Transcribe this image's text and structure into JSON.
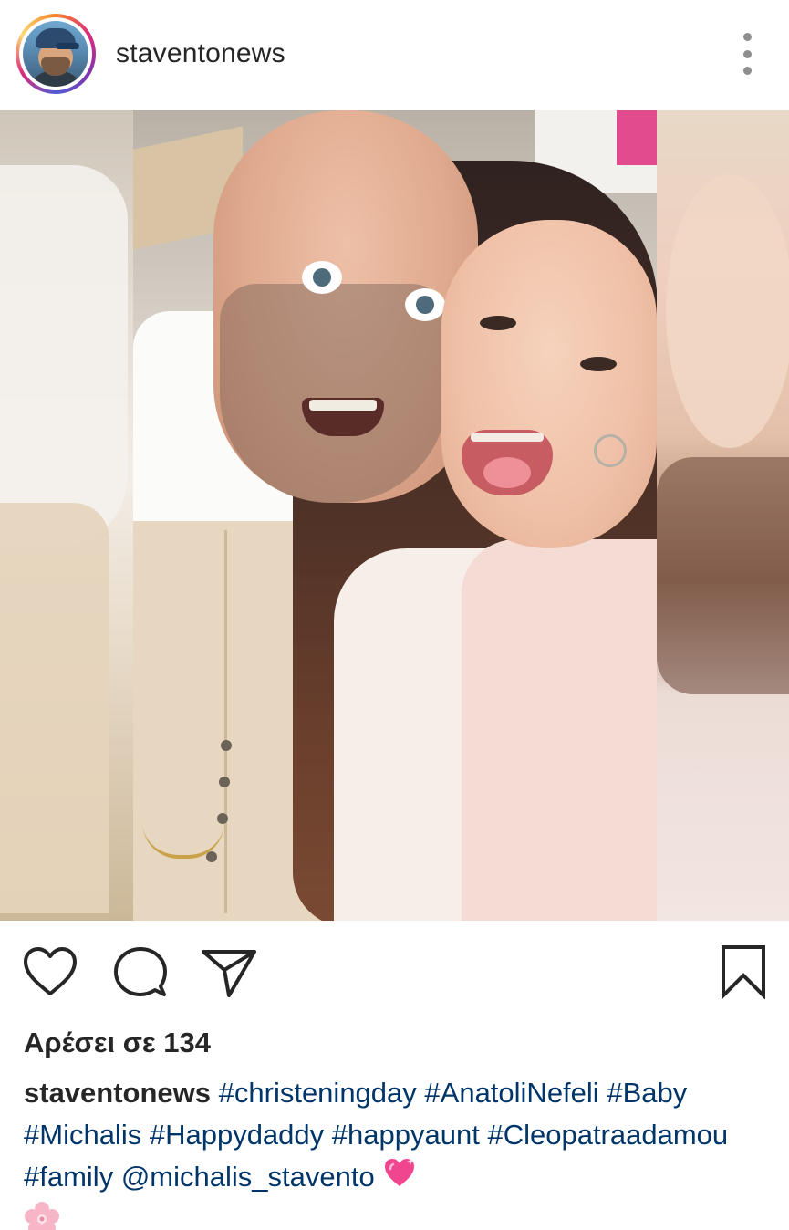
{
  "post": {
    "username": "staventonews",
    "likes_text": "Αρέσει σε 134",
    "caption": {
      "username": "staventonews",
      "segments": [
        "#christeningday",
        "#AnatoliNefeli",
        "#Baby",
        "#Michalis",
        "#Happydaddy",
        "#happyaunt",
        "#Cleopatraadamou",
        "#family",
        "@michalis_stavento"
      ],
      "emojis": [
        "sparkling-heart",
        "cherry-blossom"
      ]
    }
  },
  "icons": {
    "more": "more-options-icon",
    "like": "heart-icon",
    "comment": "comment-icon",
    "share": "send-icon",
    "save": "bookmark-icon"
  },
  "colors": {
    "text": "#262626",
    "hashtag": "#003569",
    "muted": "#8e8e8e"
  }
}
